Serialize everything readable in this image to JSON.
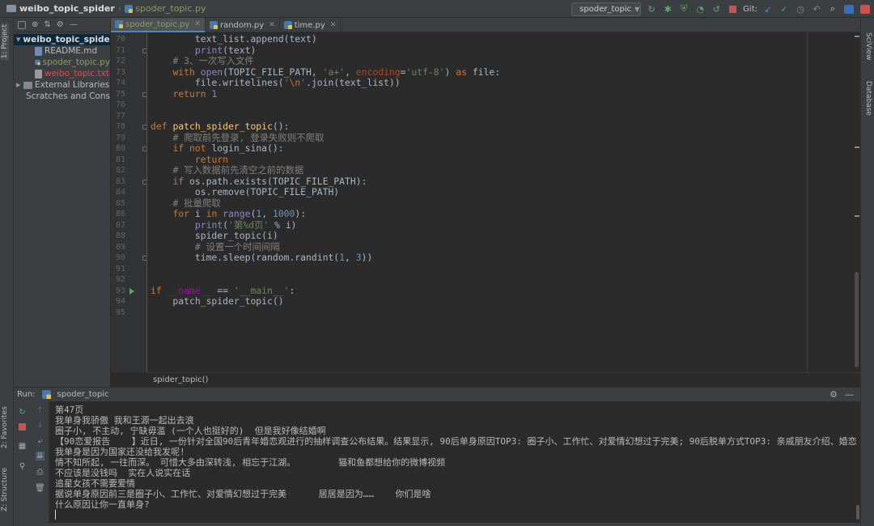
{
  "nav": {
    "project": "weibo_topic_spider",
    "file": "spoder_topic.py",
    "run_config": "spoder_topic",
    "git_label": "Git:"
  },
  "left_tabs": {
    "project": "1: Project",
    "favorites": "2: Favorites",
    "structure": "Z: Structure"
  },
  "right_tabs": {
    "sciview": "SciView",
    "database": "Database"
  },
  "tree": [
    {
      "label": "weibo_topic_spider",
      "kind": "root",
      "color": "#dcdcdc"
    },
    {
      "label": "README.md",
      "kind": "md",
      "color": "#bbbbbb"
    },
    {
      "label": "spoder_topic.py",
      "kind": "py",
      "color": "#8e9c63"
    },
    {
      "label": "weibo_topic.txt",
      "kind": "txt",
      "color": "#d25252"
    },
    {
      "label": "External Libraries",
      "kind": "lib",
      "color": "#bbbbbb"
    },
    {
      "label": "Scratches and Consoles",
      "kind": "scratch",
      "color": "#bbbbbb"
    }
  ],
  "tabs": [
    {
      "label": "spoder_topic.py",
      "active": true
    },
    {
      "label": "random.py",
      "active": false
    },
    {
      "label": "time.py",
      "active": false
    }
  ],
  "editor": {
    "line_numbers": [
      "70",
      "71",
      "72",
      "73",
      "74",
      "75",
      "76",
      "77",
      "78",
      "79",
      "80",
      "81",
      "82",
      "83",
      "84",
      "85",
      "86",
      "87",
      "88",
      "89",
      "90",
      "91",
      "92",
      "93",
      "94",
      "95"
    ],
    "breadcrumb": "spider_topic()"
  },
  "run": {
    "label": "Run:",
    "config": "spoder_topic",
    "console_lines": [
      "第47页",
      "我单身我骄傲 我和王源一起出去浪",
      "圈子小, 不主动, 宁缺毋滥 (一个人也挺好的)  但是我好像结婚啊",
      "【90恋爱报告    】近日, 一份针对全国90后青年婚恋观进行的抽样调查公布结果。结果显示, 90后单身原因TOP3: 圈子小、工作忙、对爱情幻想过于完美; 90后脱单方式TOP3: 亲戚朋友介绍、婚恋",
      "我单身是因为国家还没给我发呢!",
      "情不知所起, 一往而深。 可惜大多由深转浅, 相忘于江湖。        猫和鱼都想给你的微博视频",
      "不应该是没钱吗  实在人说实在话",
      "追星女孩不需要爱情",
      "据说单身原因前三是圈子小、工作忙、对爱情幻想过于完美      居居是因为……    你们是啥",
      "什么原因让你一直单身?"
    ]
  },
  "colors": {
    "background": "#2b2b2b",
    "panel": "#3c3f41",
    "keyword": "#cc7832",
    "function": "#ffc66d",
    "string": "#6a8759",
    "number": "#6897bb",
    "comment": "#808080"
  }
}
